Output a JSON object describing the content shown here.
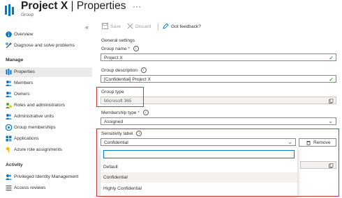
{
  "header": {
    "title": "Project X",
    "separator": " | ",
    "section": "Properties",
    "subtitle": "Group",
    "more": "···"
  },
  "sidebar": {
    "collapse": "«",
    "items_top": [
      {
        "label": "Overview",
        "icon": "info-icon"
      },
      {
        "label": "Diagnose and solve problems",
        "icon": "wrench-icon"
      }
    ],
    "manage_heading": "Manage",
    "manage_items": [
      {
        "label": "Properties",
        "icon": "properties-icon",
        "active": true
      },
      {
        "label": "Members",
        "icon": "members-icon"
      },
      {
        "label": "Owners",
        "icon": "owners-icon"
      },
      {
        "label": "Roles and administrators",
        "icon": "roles-icon"
      },
      {
        "label": "Administrative units",
        "icon": "admin-units-icon"
      },
      {
        "label": "Group memberships",
        "icon": "group-memberships-icon"
      },
      {
        "label": "Applications",
        "icon": "applications-icon"
      },
      {
        "label": "Azure role assignments",
        "icon": "key-icon"
      }
    ],
    "activity_heading": "Activity",
    "activity_items": [
      {
        "label": "Privileged Identity Management",
        "icon": "pim-icon"
      },
      {
        "label": "Access reviews",
        "icon": "access-reviews-icon"
      }
    ]
  },
  "toolbar": {
    "save": "Save",
    "discard": "Discard",
    "feedback": "Got feedback?"
  },
  "form": {
    "section_title": "General settings",
    "group_name_label": "Group name",
    "group_name_value": "Project X",
    "group_description_label": "Group description",
    "group_description_value": "[Confidential] Project X",
    "group_type_label": "Group type",
    "group_type_value": "Microsoft 365",
    "membership_type_label": "Membership type",
    "membership_type_value": "Assigned",
    "sensitivity_label_label": "Sensitivity label",
    "sensitivity_label_value": "Confidential",
    "remove_button": "Remove",
    "required_mark": "*",
    "info_mark": "i"
  },
  "dropdown": {
    "search_value": "",
    "options": [
      {
        "label": "Default",
        "selected": false
      },
      {
        "label": "Confidential",
        "selected": true
      },
      {
        "label": "Highly Confidential",
        "selected": false
      }
    ]
  },
  "colors": {
    "accent": "#0078d4",
    "highlight": "#d13438",
    "success": "#107c10"
  }
}
